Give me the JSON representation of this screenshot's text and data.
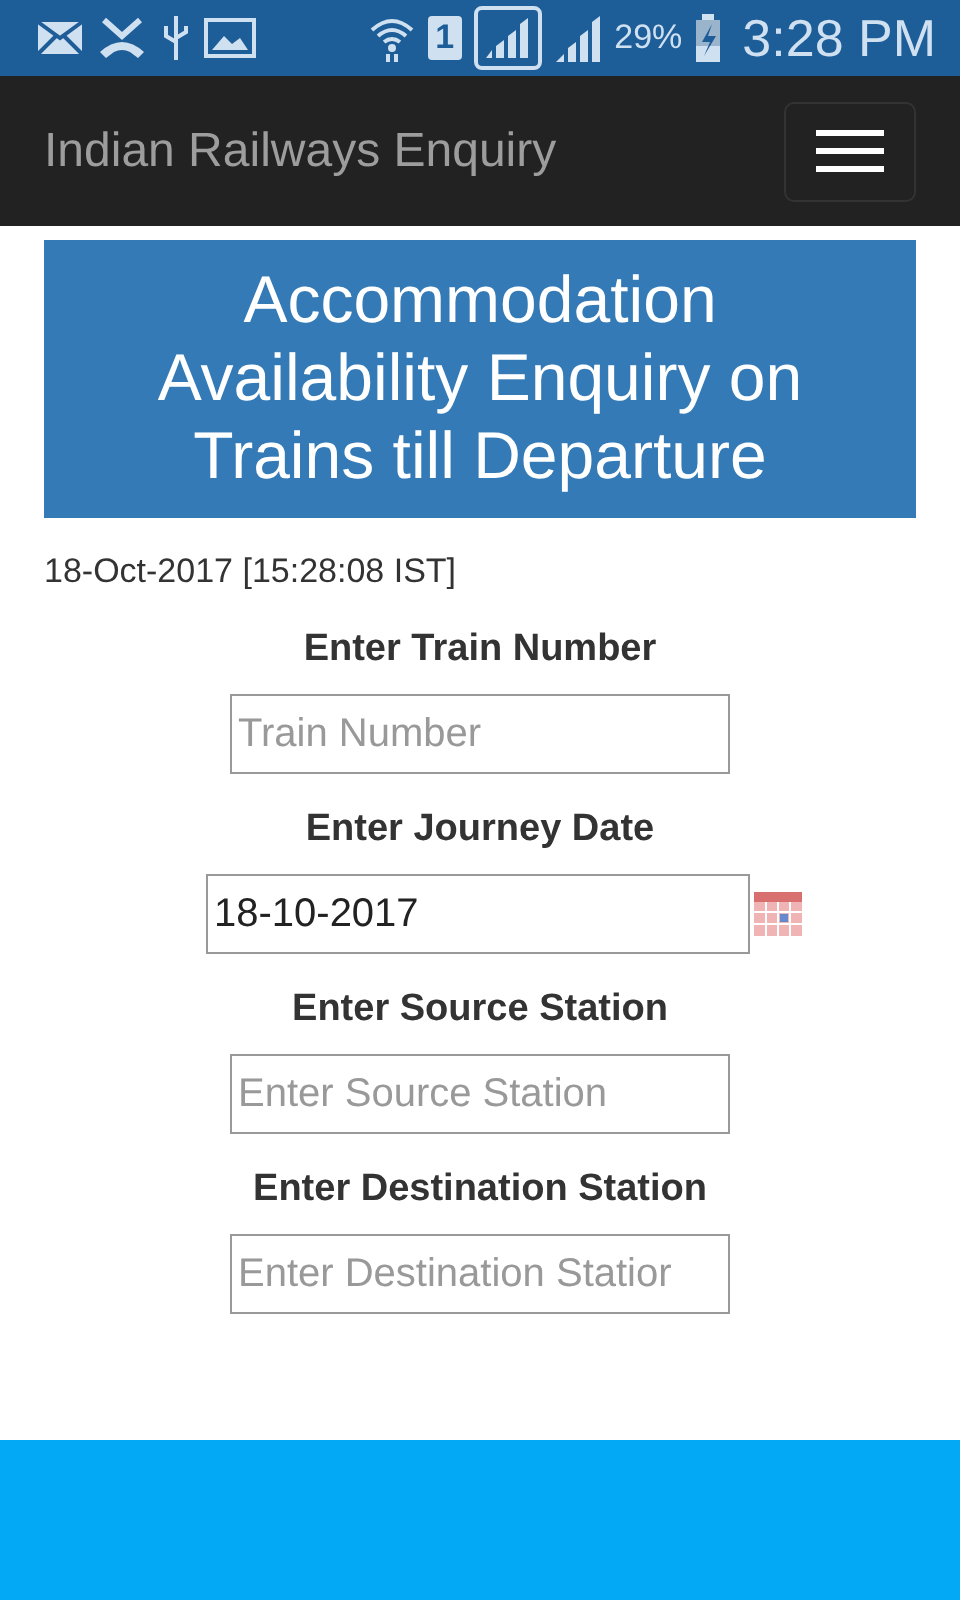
{
  "status_bar": {
    "sim": "1",
    "battery": "29%",
    "time": "3:28 PM"
  },
  "navbar": {
    "title": "Indian Railways Enquiry"
  },
  "heading": "Accommodation Availability Enquiry on Trains till Departure",
  "timestamp": "18-Oct-2017 [15:28:08 IST]",
  "fields": [
    {
      "label": "Enter Train Number",
      "placeholder": "Train Number",
      "kind": "text"
    },
    {
      "label": "Enter Journey Date",
      "value": "18-10-2017",
      "kind": "date"
    },
    {
      "label": "Enter Source Station",
      "placeholder": "Enter Source Station",
      "kind": "text"
    },
    {
      "label": "Enter Destination Station",
      "placeholder": "Enter Destination Statior",
      "kind": "text"
    }
  ]
}
